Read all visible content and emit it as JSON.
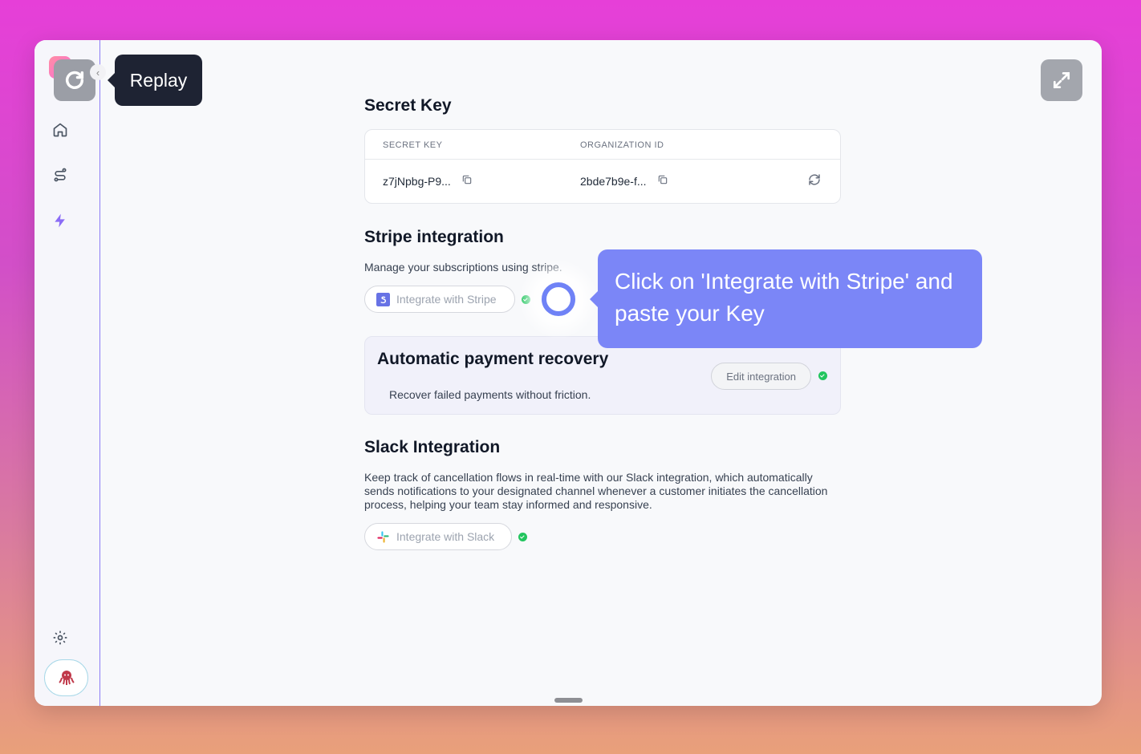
{
  "replay": {
    "label": "Replay"
  },
  "sidebar": {
    "items": [
      {
        "icon": "home-icon"
      },
      {
        "icon": "route-icon"
      },
      {
        "icon": "lightning-icon"
      },
      {
        "icon": "settings-icon"
      }
    ]
  },
  "secret_key": {
    "title": "Secret Key",
    "col_secret": "SECRET KEY",
    "col_org": "ORGANIZATION ID",
    "secret_value": "z7jNpbg-P9...",
    "org_value": "2bde7b9e-f..."
  },
  "stripe": {
    "title": "Stripe integration",
    "description": "Manage your subscriptions using stripe.",
    "button_label": "Integrate with Stripe"
  },
  "recovery": {
    "title": "Automatic payment recovery",
    "description": "Recover failed payments without friction.",
    "edit_label": "Edit integration"
  },
  "slack": {
    "title": "Slack Integration",
    "description": "Keep track of cancellation flows in real-time with our Slack integration, which automatically sends notifications to your designated channel whenever a customer initiates the cancellation process, helping your team stay informed and responsive.",
    "button_label": "Integrate with Slack"
  },
  "guide": {
    "text": "Click on 'Integrate with Stripe' and paste your Key"
  },
  "colors": {
    "accent": "#7b86f7",
    "sidebar_border": "#8b7cf6",
    "success": "#22c55e"
  }
}
